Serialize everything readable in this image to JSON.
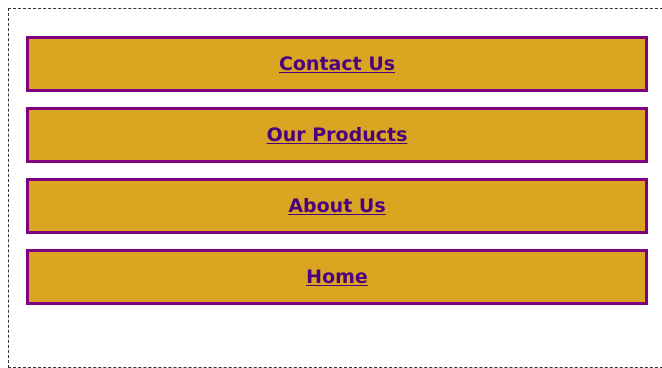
{
  "colors": {
    "item_background": "#DAA520",
    "item_border": "#800080",
    "link_text": "#4B0082",
    "frame_border": "#333333",
    "page_background": "#FFFFFF"
  },
  "nav": {
    "items": [
      {
        "label": "Contact Us"
      },
      {
        "label": "Our Products"
      },
      {
        "label": "About Us"
      },
      {
        "label": "Home"
      }
    ]
  }
}
